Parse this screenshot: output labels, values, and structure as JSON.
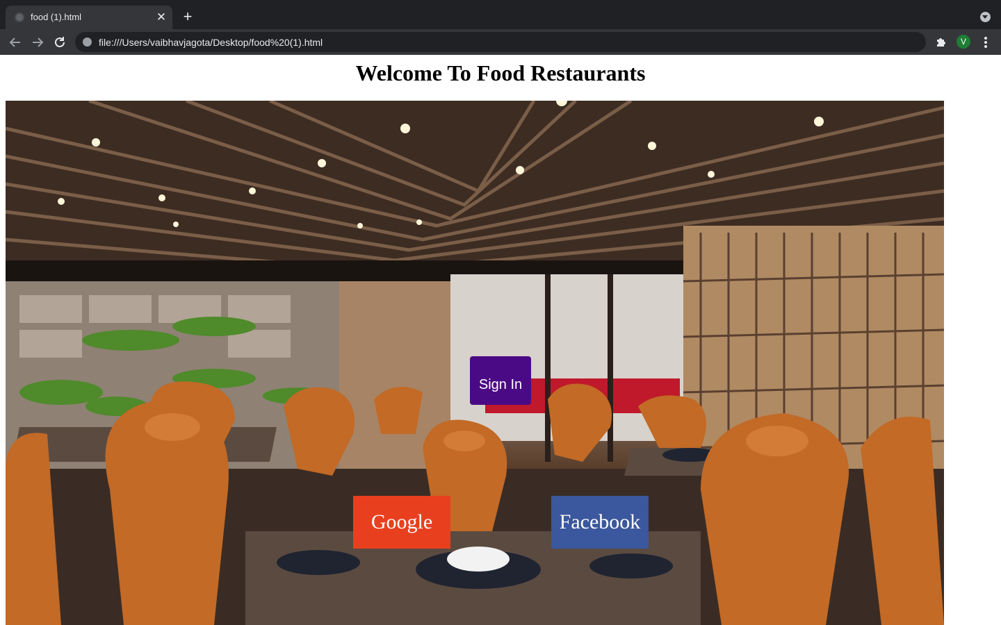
{
  "browser": {
    "tab_title": "food (1).html",
    "tab_close_glyph": "✕",
    "new_tab_glyph": "+",
    "url": "file:///Users/vaibhavjagota/Desktop/food%20(1).html",
    "profile_initial": "V",
    "icons": {
      "back": "back-arrow-icon",
      "forward": "forward-arrow-icon",
      "reload": "reload-icon",
      "site_info": "site-info-icon",
      "extensions": "puzzle-icon",
      "menu": "kebab-menu-icon",
      "tab_search": "chevron-down-icon"
    }
  },
  "page": {
    "title": "Welcome To Food Restaurants",
    "hero_image": "restaurant-interior-image",
    "buttons": {
      "sign_in": "Sign In",
      "google": "Google",
      "facebook": "Facebook"
    },
    "colors": {
      "sign_in": "#4b0a85",
      "google": "#e8401f",
      "facebook": "#3b579d"
    }
  }
}
